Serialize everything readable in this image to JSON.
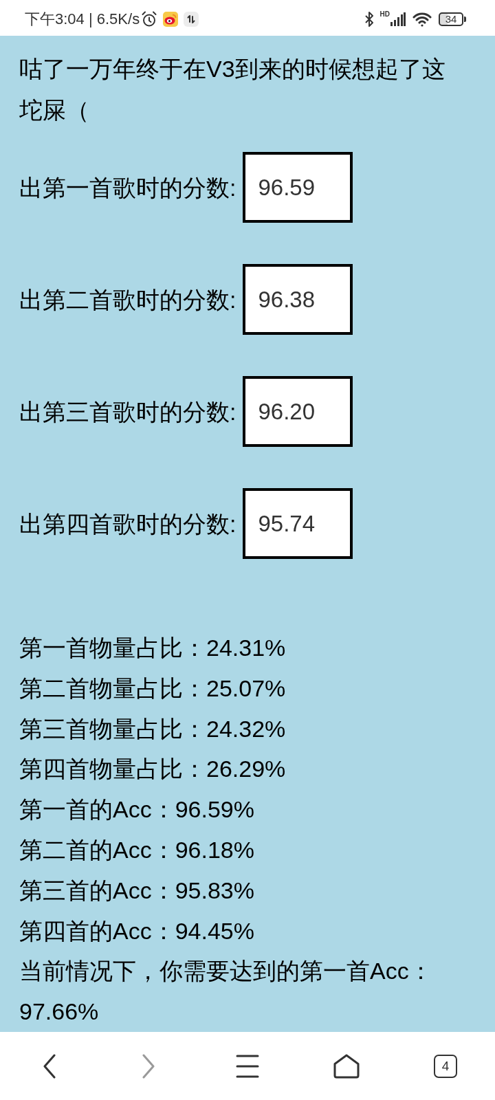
{
  "status_bar": {
    "time": "下午3:04 | 6.5K/s",
    "signal_label": "HD",
    "battery": "34"
  },
  "page": {
    "title": "咕了一万年终于在V3到来的时候想起了这坨屎（",
    "fields": [
      {
        "label": "出第一首歌时的分数:",
        "value": "96.59"
      },
      {
        "label": "出第二首歌时的分数:",
        "value": "96.38"
      },
      {
        "label": "出第三首歌时的分数:",
        "value": "96.20"
      },
      {
        "label": "出第四首歌时的分数:",
        "value": "95.74"
      }
    ],
    "results": [
      "第一首物量占比：24.31%",
      "第二首物量占比：25.07%",
      "第三首物量占比：24.32%",
      "第四首物量占比：26.29%",
      "第一首的Acc：96.59%",
      "第二首的Acc：96.18%",
      "第三首的Acc：95.83%",
      "第四首的Acc：94.45%",
      "当前情况下，你需要达到的第一首Acc：97.66%"
    ]
  },
  "nav_bar": {
    "items": [
      {
        "kind": "back",
        "disabled": false
      },
      {
        "kind": "forward",
        "disabled": true
      },
      {
        "kind": "menu",
        "disabled": false
      },
      {
        "kind": "home",
        "disabled": false
      },
      {
        "kind": "tabs",
        "disabled": false,
        "count": "4"
      }
    ]
  }
}
